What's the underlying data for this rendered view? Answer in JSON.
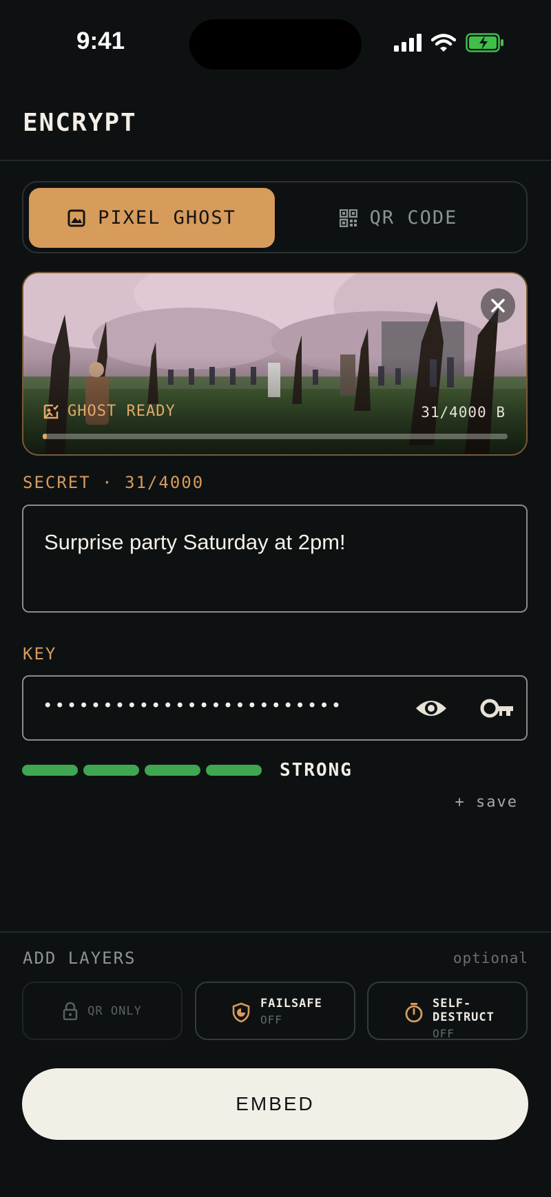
{
  "status_bar": {
    "time": "9:41"
  },
  "header": {
    "title": "ENCRYPT"
  },
  "mode_toggle": {
    "options": [
      {
        "label": "PIXEL GHOST",
        "icon": "image-icon",
        "active": true
      },
      {
        "label": "QR CODE",
        "icon": "qr-icon",
        "active": false
      }
    ]
  },
  "carrier": {
    "status": "GHOST READY",
    "bytes": "31/4000 B",
    "capacity_used_fraction": 0.00775
  },
  "secret": {
    "label": "SECRET · 31/4000",
    "value": "Surprise party Saturday at 2pm!"
  },
  "key": {
    "label": "KEY",
    "masked_value": "•••••••••••••••••••••••••",
    "strength_label": "STRONG",
    "strength_level": 4,
    "strength_max": 4,
    "save_label": "+ save"
  },
  "layers": {
    "title": "ADD LAYERS",
    "optional_label": "optional",
    "items": [
      {
        "name": "QR ONLY",
        "icon": "lock-icon",
        "enabled": false
      },
      {
        "name": "FAILSAFE",
        "state": "OFF",
        "icon": "shield-icon"
      },
      {
        "name": "SELF-DESTRUCT",
        "state": "OFF",
        "icon": "timer-icon"
      }
    ]
  },
  "primary_action": {
    "label": "EMBED"
  },
  "colors": {
    "accent": "#d79b5b",
    "strength": "#3fa652",
    "background": "#0e1112"
  }
}
